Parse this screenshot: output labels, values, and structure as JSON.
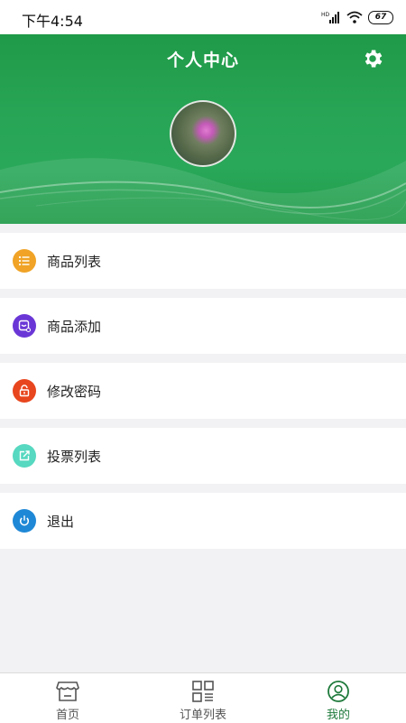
{
  "status_bar": {
    "time": "下午4:54",
    "battery": "67",
    "signal_tag": "HD"
  },
  "header": {
    "title": "个人中心",
    "settings_icon": "gear-icon"
  },
  "menu": {
    "items": [
      {
        "label": "商品列表",
        "icon": "list-icon",
        "color": "#f0a326"
      },
      {
        "label": "商品添加",
        "icon": "add-item-icon",
        "color": "#6a37d6"
      },
      {
        "label": "修改密码",
        "icon": "unlock-icon",
        "color": "#e8461e"
      },
      {
        "label": "投票列表",
        "icon": "share-icon",
        "color": "#57d8c0"
      },
      {
        "label": "退出",
        "icon": "power-icon",
        "color": "#1f88d6"
      }
    ]
  },
  "tabbar": {
    "tabs": [
      {
        "label": "首页",
        "icon": "store-icon"
      },
      {
        "label": "订单列表",
        "icon": "grid-list-icon"
      },
      {
        "label": "我的",
        "icon": "user-icon"
      }
    ],
    "active_color": "#1f7a3c"
  }
}
